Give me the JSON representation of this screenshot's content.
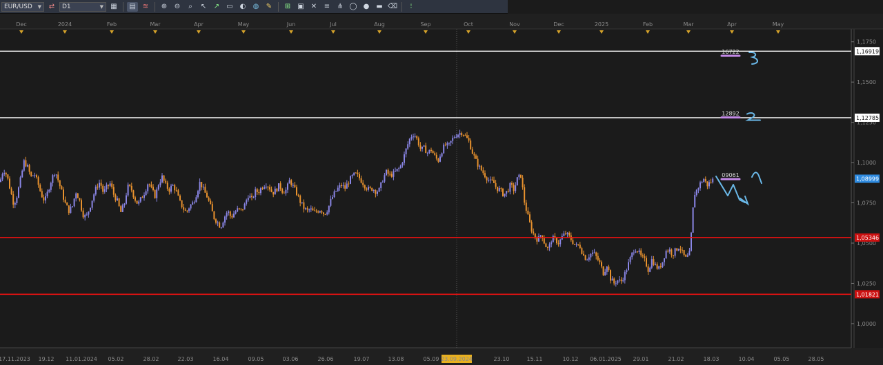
{
  "toolbar": {
    "symbol": "EUR/USD",
    "timeframe": "D1",
    "icons": [
      "chart-type-icon",
      "line-icon",
      "grid-icon",
      "indicator-icon",
      "zoom-in-icon",
      "zoom-out-icon",
      "crosshair-icon",
      "fibonacci-icon",
      "text-icon",
      "palette-icon",
      "pencil-icon",
      "trend-icon",
      "template-icon",
      "cross-tool-icon",
      "channel-icon",
      "pitchfork-icon",
      "ellipse-icon",
      "eraser-icon",
      "more-icon"
    ]
  },
  "chart_data": {
    "type": "candlestick",
    "symbol": "EUR/USD",
    "timeframe": "D1",
    "ylim": [
      0.985,
      1.183
    ],
    "y_ticks": [
      "1,0000",
      "1,0250",
      "1,0500",
      "1,0750",
      "1,1000",
      "1,1250",
      "1,1500",
      "1,1750"
    ],
    "y_tick_values": [
      1.0,
      1.025,
      1.05,
      1.075,
      1.1,
      1.125,
      1.15,
      1.175
    ],
    "top_axis_labels": [
      "Dec",
      "2024",
      "Feb",
      "Mar",
      "Apr",
      "May",
      "Jun",
      "Jul",
      "Aug",
      "Sep",
      "Oct",
      "Nov",
      "Dec",
      "2025",
      "Feb",
      "Mar",
      "Apr",
      "May"
    ],
    "bottom_axis_labels": [
      "17.11.2023",
      "19.12",
      "11.01.2024",
      "05.02",
      "28.02",
      "22.03",
      "16.04",
      "09.05",
      "03.06",
      "26.06",
      "19.07",
      "13.08",
      "05.09",
      "23.09.2024",
      "23.10",
      "15.11",
      "10.12",
      "06.01.2025",
      "29.01",
      "21.02",
      "18.03",
      "10.04",
      "05.05",
      "28.05"
    ],
    "highlighted_date": "23.09.2024",
    "current_price": "1,08999",
    "price_lines": [
      {
        "value": 1.16919,
        "label": "1,16919",
        "color": "#ffffff"
      },
      {
        "value": 1.12785,
        "label": "1,12785",
        "color": "#ffffff"
      },
      {
        "value": 1.05346,
        "label": "1,05346",
        "color": "#ee1111"
      },
      {
        "value": 1.01821,
        "label": "1,01821",
        "color": "#ee1111"
      }
    ],
    "annotations": [
      {
        "text": "16722",
        "value": 1.1672,
        "mark": "3"
      },
      {
        "text": "12892",
        "value": 1.1289,
        "mark": "2"
      },
      {
        "text": "09061",
        "value": 1.0906,
        "mark": ""
      }
    ],
    "price_path": [
      [
        0,
        1.088
      ],
      [
        5,
        1.096
      ],
      [
        10,
        1.092
      ],
      [
        15,
        1.083
      ],
      [
        20,
        1.074
      ],
      [
        25,
        1.08
      ],
      [
        30,
        1.09
      ],
      [
        35,
        1.101
      ],
      [
        40,
        1.097
      ],
      [
        45,
        1.091
      ],
      [
        50,
        1.093
      ],
      [
        55,
        1.087
      ],
      [
        60,
        1.08
      ],
      [
        65,
        1.076
      ],
      [
        70,
        1.083
      ],
      [
        75,
        1.09
      ],
      [
        80,
        1.095
      ],
      [
        85,
        1.088
      ],
      [
        90,
        1.081
      ],
      [
        95,
        1.074
      ],
      [
        100,
        1.07
      ],
      [
        105,
        1.073
      ],
      [
        110,
        1.082
      ],
      [
        115,
        1.077
      ],
      [
        120,
        1.068
      ],
      [
        125,
        1.066
      ],
      [
        130,
        1.072
      ],
      [
        135,
        1.079
      ],
      [
        140,
        1.085
      ],
      [
        145,
        1.088
      ],
      [
        150,
        1.081
      ],
      [
        155,
        1.085
      ],
      [
        160,
        1.087
      ],
      [
        165,
        1.08
      ],
      [
        170,
        1.076
      ],
      [
        175,
        1.069
      ],
      [
        180,
        1.074
      ],
      [
        185,
        1.085
      ],
      [
        190,
        1.084
      ],
      [
        195,
        1.078
      ],
      [
        200,
        1.074
      ],
      [
        205,
        1.078
      ],
      [
        210,
        1.082
      ],
      [
        215,
        1.088
      ],
      [
        220,
        1.083
      ],
      [
        225,
        1.079
      ],
      [
        230,
        1.087
      ],
      [
        235,
        1.091
      ],
      [
        240,
        1.086
      ],
      [
        245,
        1.083
      ],
      [
        250,
        1.086
      ],
      [
        255,
        1.083
      ],
      [
        260,
        1.076
      ],
      [
        265,
        1.072
      ],
      [
        270,
        1.069
      ],
      [
        275,
        1.073
      ],
      [
        280,
        1.075
      ],
      [
        285,
        1.081
      ],
      [
        290,
        1.088
      ],
      [
        295,
        1.083
      ],
      [
        300,
        1.079
      ],
      [
        305,
        1.073
      ],
      [
        310,
        1.066
      ],
      [
        315,
        1.063
      ],
      [
        320,
        1.06
      ],
      [
        325,
        1.066
      ],
      [
        330,
        1.07
      ],
      [
        335,
        1.066
      ],
      [
        340,
        1.069
      ],
      [
        345,
        1.071
      ],
      [
        350,
        1.07
      ],
      [
        355,
        1.074
      ],
      [
        360,
        1.08
      ],
      [
        365,
        1.077
      ],
      [
        370,
        1.082
      ],
      [
        375,
        1.082
      ],
      [
        380,
        1.085
      ],
      [
        385,
        1.087
      ],
      [
        390,
        1.085
      ],
      [
        395,
        1.081
      ],
      [
        400,
        1.083
      ],
      [
        405,
        1.086
      ],
      [
        410,
        1.082
      ],
      [
        415,
        1.083
      ],
      [
        420,
        1.089
      ],
      [
        425,
        1.085
      ],
      [
        430,
        1.081
      ],
      [
        435,
        1.076
      ],
      [
        440,
        1.072
      ],
      [
        445,
        1.07
      ],
      [
        450,
        1.071
      ],
      [
        455,
        1.069
      ],
      [
        460,
        1.07
      ],
      [
        465,
        1.071
      ],
      [
        470,
        1.068
      ],
      [
        475,
        1.071
      ],
      [
        480,
        1.077
      ],
      [
        485,
        1.081
      ],
      [
        490,
        1.084
      ],
      [
        495,
        1.086
      ],
      [
        500,
        1.084
      ],
      [
        505,
        1.088
      ],
      [
        510,
        1.091
      ],
      [
        515,
        1.093
      ],
      [
        520,
        1.091
      ],
      [
        525,
        1.088
      ],
      [
        530,
        1.085
      ],
      [
        535,
        1.083
      ],
      [
        540,
        1.084
      ],
      [
        545,
        1.082
      ],
      [
        550,
        1.083
      ],
      [
        555,
        1.09
      ],
      [
        560,
        1.094
      ],
      [
        565,
        1.092
      ],
      [
        570,
        1.093
      ],
      [
        575,
        1.095
      ],
      [
        580,
        1.097
      ],
      [
        585,
        1.103
      ],
      [
        590,
        1.11
      ],
      [
        595,
        1.116
      ],
      [
        600,
        1.118
      ],
      [
        605,
        1.114
      ],
      [
        610,
        1.108
      ],
      [
        615,
        1.109
      ],
      [
        620,
        1.106
      ],
      [
        625,
        1.108
      ],
      [
        630,
        1.104
      ],
      [
        635,
        1.101
      ],
      [
        640,
        1.107
      ],
      [
        645,
        1.111
      ],
      [
        650,
        1.11
      ],
      [
        655,
        1.114
      ],
      [
        660,
        1.117
      ],
      [
        665,
        1.118
      ],
      [
        670,
        1.119
      ],
      [
        675,
        1.116
      ],
      [
        680,
        1.113
      ],
      [
        685,
        1.106
      ],
      [
        690,
        1.101
      ],
      [
        695,
        1.097
      ],
      [
        700,
        1.094
      ],
      [
        705,
        1.091
      ],
      [
        710,
        1.088
      ],
      [
        715,
        1.088
      ],
      [
        720,
        1.084
      ],
      [
        725,
        1.083
      ],
      [
        730,
        1.08
      ],
      [
        735,
        1.082
      ],
      [
        740,
        1.086
      ],
      [
        745,
        1.083
      ],
      [
        750,
        1.09
      ],
      [
        755,
        1.092
      ],
      [
        760,
        1.076
      ],
      [
        765,
        1.067
      ],
      [
        770,
        1.059
      ],
      [
        775,
        1.054
      ],
      [
        780,
        1.052
      ],
      [
        785,
        1.056
      ],
      [
        790,
        1.049
      ],
      [
        795,
        1.046
      ],
      [
        800,
        1.053
      ],
      [
        805,
        1.052
      ],
      [
        810,
        1.05
      ],
      [
        815,
        1.054
      ],
      [
        820,
        1.056
      ],
      [
        825,
        1.054
      ],
      [
        830,
        1.051
      ],
      [
        835,
        1.048
      ],
      [
        840,
        1.049
      ],
      [
        845,
        1.043
      ],
      [
        850,
        1.04
      ],
      [
        855,
        1.043
      ],
      [
        860,
        1.044
      ],
      [
        865,
        1.041
      ],
      [
        870,
        1.037
      ],
      [
        875,
        1.031
      ],
      [
        880,
        1.037
      ],
      [
        885,
        1.028
      ],
      [
        890,
        1.025
      ],
      [
        895,
        1.027
      ],
      [
        900,
        1.026
      ],
      [
        905,
        1.03
      ],
      [
        910,
        1.036
      ],
      [
        915,
        1.042
      ],
      [
        920,
        1.047
      ],
      [
        925,
        1.045
      ],
      [
        930,
        1.041
      ],
      [
        935,
        1.039
      ],
      [
        940,
        1.033
      ],
      [
        945,
        1.04
      ],
      [
        950,
        1.036
      ],
      [
        955,
        1.034
      ],
      [
        960,
        1.038
      ],
      [
        965,
        1.045
      ],
      [
        970,
        1.046
      ],
      [
        975,
        1.043
      ],
      [
        980,
        1.046
      ],
      [
        985,
        1.048
      ],
      [
        990,
        1.043
      ],
      [
        995,
        1.04
      ],
      [
        1000,
        1.044
      ],
      [
        1003,
        1.061
      ],
      [
        1006,
        1.08
      ],
      [
        1010,
        1.083
      ],
      [
        1015,
        1.087
      ],
      [
        1020,
        1.09
      ],
      [
        1025,
        1.086
      ],
      [
        1030,
        1.088
      ],
      [
        1035,
        1.09
      ]
    ]
  }
}
